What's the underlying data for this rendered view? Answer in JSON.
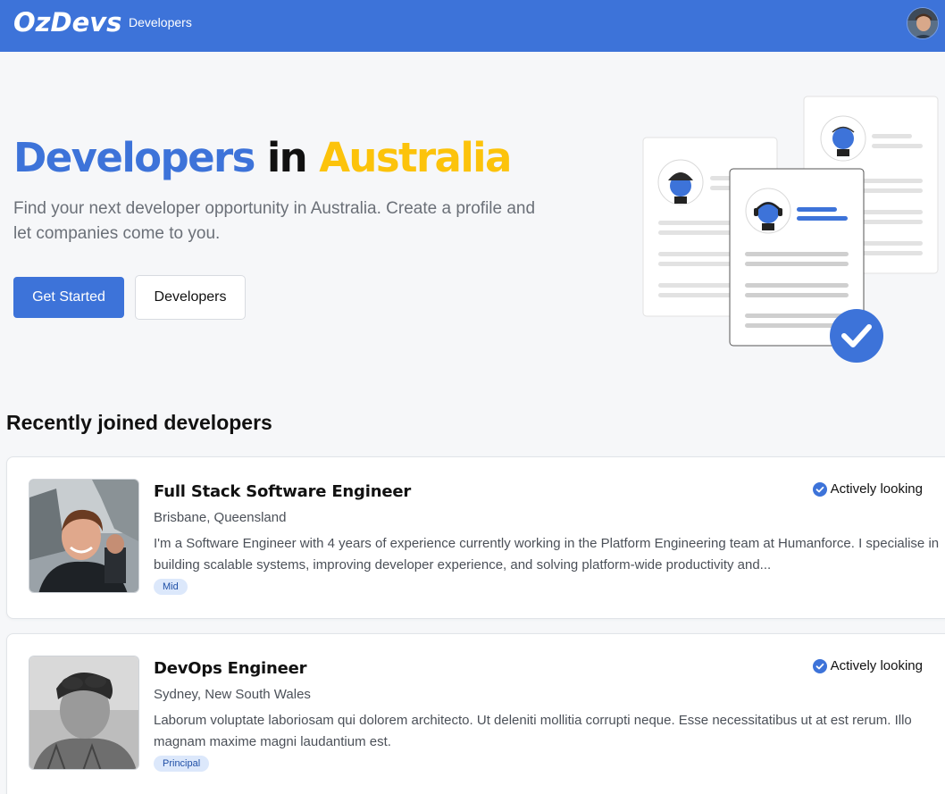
{
  "navbar": {
    "logo": "OzDevs",
    "link_developers": "Developers"
  },
  "hero": {
    "title_part1": "Developers",
    "title_part2": "in",
    "title_part3": "Australia",
    "subtitle": "Find your next developer opportunity in Australia. Create a profile and let companies come to you.",
    "primary_button": "Get Started",
    "secondary_button": "Developers"
  },
  "section": {
    "title": "Recently joined developers"
  },
  "developers": [
    {
      "title": "Full Stack Software Engineer",
      "location": "Brisbane, Queensland",
      "description": "I'm a Software Engineer with 4 years of experience currently working in the Platform Engineering team at Humanforce. I specialise in building scalable systems, improving developer experience, and solving platform-wide productivity and...",
      "level": "Mid",
      "status": "Actively looking"
    },
    {
      "title": "DevOps Engineer",
      "location": "Sydney, New South Wales",
      "description": "Laborum voluptate laboriosam qui dolorem architecto. Ut deleniti mollitia corrupti neque. Esse necessitatibus ut at est rerum. Illo magnam maxime magni laudantium est.",
      "level": "Principal",
      "status": "Actively looking"
    }
  ],
  "colors": {
    "brand_blue": "#3d73d9",
    "accent_yellow": "#fcc30b",
    "badge_bg": "#dce8fb"
  }
}
